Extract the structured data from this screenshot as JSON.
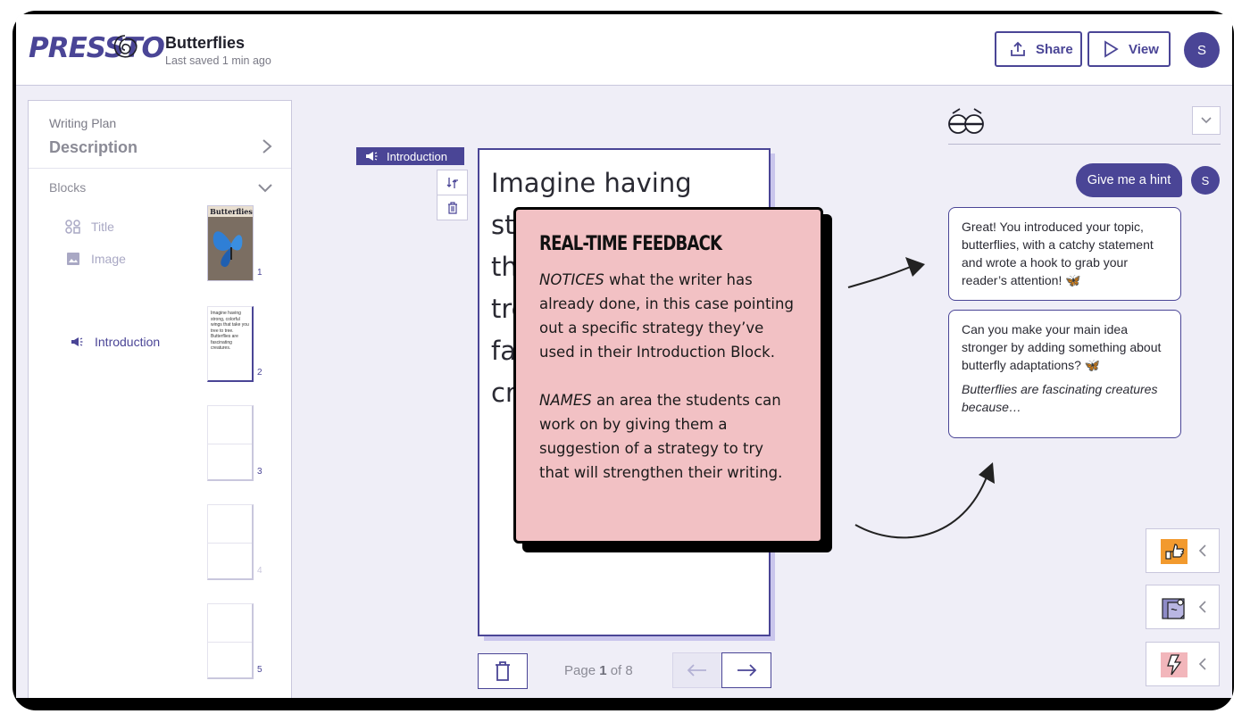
{
  "app": {
    "logo": "PRESSTO"
  },
  "header": {
    "doc_title": "Butterflies",
    "saved_text": "Last saved 1 min ago",
    "share_label": "Share",
    "view_label": "View",
    "avatar_initial": "S"
  },
  "sidebar": {
    "plan_label": "Writing Plan",
    "plan_value": "Description",
    "blocks_label": "Blocks",
    "blocks": [
      {
        "label": "Title",
        "icon": "title-icon"
      },
      {
        "label": "Image",
        "icon": "image-icon"
      },
      {
        "label": "Introduction",
        "icon": "megaphone-icon"
      }
    ],
    "thumbnails": [
      {
        "page": "1",
        "title": "Butterflies"
      },
      {
        "page": "2",
        "text": "Imagine having strong, colorful wings that take you tree to tree. Butterflies are fascinating creatures."
      },
      {
        "page": "3"
      },
      {
        "page": "4"
      },
      {
        "page": "5"
      }
    ]
  },
  "editor": {
    "block_tag": "Introduction",
    "lines": [
      "Imagine having",
      "st",
      "th",
      "tre",
      "fa",
      "cr"
    ],
    "pager": {
      "prefix": "Page ",
      "current": "1",
      "suffix": " of 8"
    }
  },
  "callout": {
    "title": "REAL-TIME FEEDBACK",
    "p1_em": "NOTICES",
    "p1_rest": " what the writer has already done, in this case pointing out a specific strategy they’ve used in their Introduction Block.",
    "p2_em": "NAMES",
    "p2_rest": " an area the students can work on by giving them a suggestion of a strategy to try that will strengthen their writing."
  },
  "chat": {
    "hint_label": "Give me a hint",
    "avatar_initial": "S",
    "feedback1": "Great! You introduced your topic, butterflies, with a catchy statement and wrote a hook to grab your reader’s attention! ",
    "feedback2": "Can you make your main idea stronger by adding something about butterfly adaptations? ",
    "feedback2_italic": "Butterflies are fascinating creatures because…",
    "emoji": "🦋"
  },
  "colors": {
    "accent": "#4a4596",
    "callout_bg": "#f2c1c4",
    "panel_bg": "#efeef7"
  },
  "tools": [
    {
      "name": "thumbs-up-sticker-icon"
    },
    {
      "name": "sticky-note-icon"
    },
    {
      "name": "lightning-icon"
    }
  ]
}
